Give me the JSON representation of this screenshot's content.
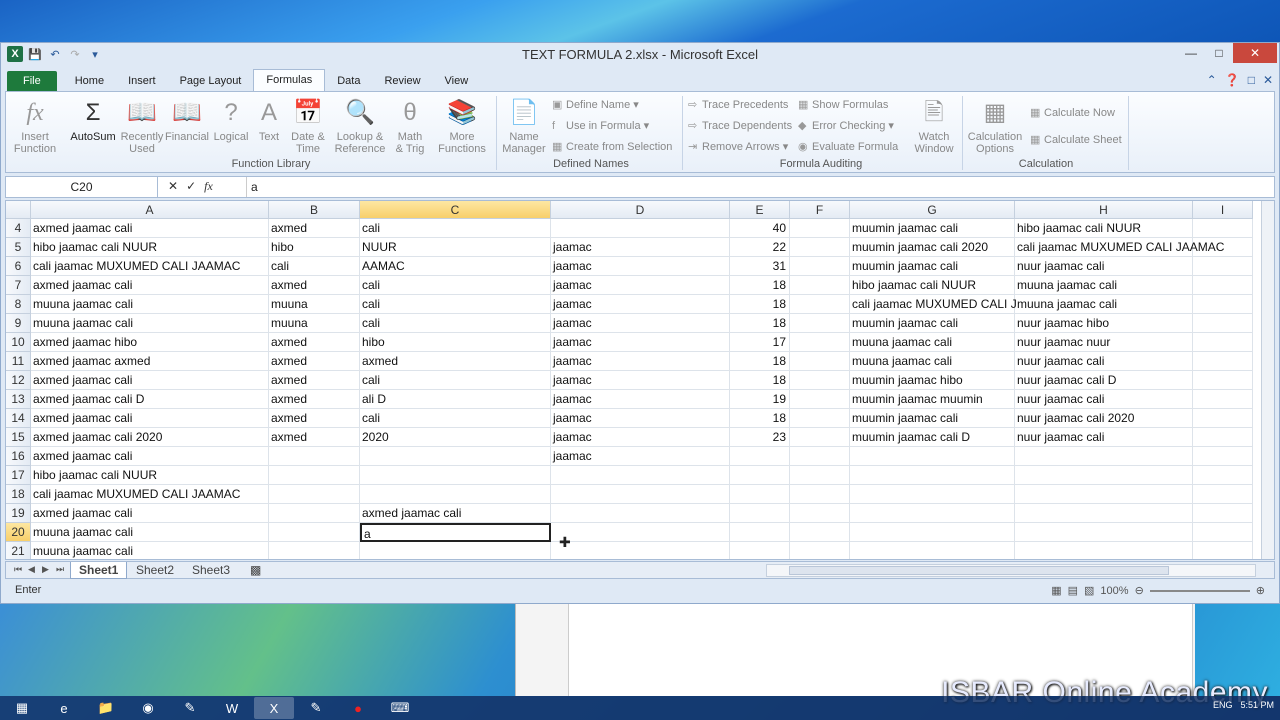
{
  "window": {
    "title": "TEXT FORMULA 2.xlsx  -  Microsoft Excel"
  },
  "tabs": [
    "File",
    "Home",
    "Insert",
    "Page Layout",
    "Formulas",
    "Data",
    "Review",
    "View"
  ],
  "ribbon": {
    "insert_function": "Insert\nFunction",
    "autosum": "AutoSum",
    "recently_used": "Recently\nUsed",
    "financial": "Financial",
    "logical": "Logical",
    "text": "Text",
    "date_time": "Date &\nTime",
    "lookup": "Lookup &\nReference",
    "math": "Math\n& Trig",
    "more": "More\nFunctions",
    "function_library": "Function Library",
    "name_manager": "Name\nManager",
    "define_name": "Define Name",
    "use_in_formula": "Use in Formula",
    "create_from_selection": "Create from Selection",
    "defined_names": "Defined Names",
    "trace_precedents": "Trace Precedents",
    "trace_dependents": "Trace Dependents",
    "remove_arrows": "Remove Arrows",
    "show_formulas": "Show Formulas",
    "error_checking": "Error Checking",
    "evaluate_formula": "Evaluate Formula",
    "watch_window": "Watch\nWindow",
    "formula_auditing": "Formula Auditing",
    "calc_options": "Calculation\nOptions",
    "calc_now": "Calculate Now",
    "calc_sheet": "Calculate Sheet",
    "calculation": "Calculation"
  },
  "formula_bar": {
    "name_box": "C20",
    "content": "a"
  },
  "columns": [
    "A",
    "B",
    "C",
    "D",
    "E",
    "F",
    "G",
    "H",
    "I"
  ],
  "rows": [
    {
      "n": "4",
      "A": "axmed        jaamac         cali",
      "B": "axmed",
      "C": "cali",
      "D": "",
      "E": "40",
      "G": "muumin jaamac cali",
      "H": "hibo jaamac cali  NUUR"
    },
    {
      "n": "5",
      "A": "hibo jaamac cali  NUUR",
      "B": "hibo",
      "C": " NUUR",
      "D": "jaamac",
      "E": "22",
      "G": "muumin jaamac cali  2020",
      "H": "cali jaamac MUXUMED CALI JAAMAC"
    },
    {
      "n": "6",
      "A": "cali jaamac MUXUMED CALI JAAMAC",
      "B": "cali",
      "C": "AAMAC",
      "D": "jaamac",
      "E": "31",
      "G": "muumin jaamac cali",
      "H": "nuur jaamac cali"
    },
    {
      "n": "7",
      "A": "axmed jaamac cali",
      "B": "axmed",
      "C": "cali",
      "D": " jaamac",
      "E": "18",
      "G": "hibo jaamac cali  NUUR",
      "H": "muuna jaamac cali"
    },
    {
      "n": "8",
      "A": "muuna jaamac cali",
      "B": "muuna",
      "C": "cali",
      "D": " jaamac",
      "E": "18",
      "G": "cali jaamac MUXUMED CALI J",
      "H": "muuna jaamac cali"
    },
    {
      "n": "9",
      "A": "muuna jaamac cali",
      "B": "muuna",
      "C": "cali",
      "D": " jaamac",
      "E": "18",
      "G": "muumin jaamac cali",
      "H": "nuur jaamac hibo"
    },
    {
      "n": "10",
      "A": "axmed jaamac hibo",
      "B": "axmed",
      "C": " hibo",
      "D": " jaamac",
      "E": "17",
      "G": "muuna jaamac cali",
      "H": "nuur jaamac nuur"
    },
    {
      "n": "11",
      "A": "axmed jaamac axmed",
      "B": "axmed",
      "C": "axmed",
      "D": " jaamac",
      "E": "18",
      "G": "muuna jaamac cali",
      "H": "nuur jaamac cali"
    },
    {
      "n": "12",
      "A": "axmed jaamac cali",
      "B": "axmed",
      "C": "cali",
      "D": " jaamac",
      "E": "18",
      "G": "muumin jaamac hibo",
      "H": "nuur jaamac cali D"
    },
    {
      "n": "13",
      "A": "axmed jaamac cali D",
      "B": "axmed",
      "C": "ali D",
      "D": " jaamac",
      "E": "19",
      "G": "muumin jaamac muumin",
      "H": "nuur jaamac cali"
    },
    {
      "n": "14",
      "A": "axmed jaamac cali",
      "B": "axmed",
      "C": "cali",
      "D": " jaamac",
      "E": "18",
      "G": "muumin jaamac cali",
      "H": "nuur jaamac cali  2020"
    },
    {
      "n": "15",
      "A": "axmed jaamac cali  2020",
      "B": "axmed",
      "C": " 2020",
      "D": " jaamac",
      "E": "23",
      "G": "muumin jaamac cali D",
      "H": "nuur jaamac cali"
    },
    {
      "n": "16",
      "A": "axmed jaamac cali",
      "B": "",
      "C": "",
      "D": " jaamac",
      "E": "",
      "G": "",
      "H": ""
    },
    {
      "n": "17",
      "A": "hibo jaamac cali  NUUR",
      "B": "",
      "C": "",
      "D": "",
      "E": "",
      "G": "",
      "H": ""
    },
    {
      "n": "18",
      "A": "cali jaamac MUXUMED CALI JAAMAC",
      "B": "",
      "C": "",
      "D": "",
      "E": "",
      "G": "",
      "H": ""
    },
    {
      "n": "19",
      "A": "axmed jaamac cali",
      "B": "",
      "C": "axmed jaamac cali",
      "D": "",
      "E": "",
      "G": "",
      "H": ""
    },
    {
      "n": "20",
      "A": "muuna jaamac cali",
      "B": "",
      "C": "a",
      "D": "",
      "E": "",
      "G": "",
      "H": ""
    },
    {
      "n": "21",
      "A": "muuna jaamac cali",
      "B": "",
      "C": "",
      "D": "",
      "E": "",
      "G": "",
      "H": ""
    }
  ],
  "sheets": [
    "Sheet1",
    "Sheet2",
    "Sheet3"
  ],
  "status": {
    "mode": "Enter",
    "zoom": "100%"
  },
  "watermark": "ISBAR Online Academy",
  "tray": {
    "lang": "ENG",
    "time": "5:51 PM"
  }
}
